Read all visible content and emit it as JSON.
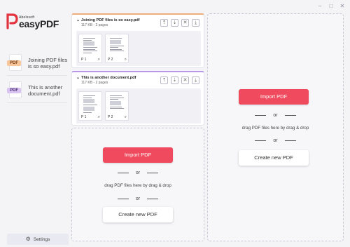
{
  "app": {
    "brand_small": "Abelssoft",
    "brand_name": "easyPDF"
  },
  "window_controls": [
    "–",
    "□",
    "✕"
  ],
  "sidebar": {
    "documents": [
      {
        "tag": "PDF",
        "line1": "Joining PDF files",
        "line2": "is so easy.pdf",
        "color": "#f7c79b"
      },
      {
        "tag": "PDF",
        "line1": "This is another",
        "line2": "document.pdf",
        "color": "#d9c4f1"
      }
    ],
    "settings_label": "Settings"
  },
  "documents": [
    {
      "name": "Joining PDF files is so easy.pdf",
      "meta": "117 KB - 2 pages",
      "accent": "#f1ad79",
      "pages": [
        "P 1",
        "P 2"
      ]
    },
    {
      "name": "This is another document.pdf",
      "meta": "117 KB - 2 pages",
      "accent": "#b897e8",
      "pages": [
        "P 1",
        "P 2"
      ]
    }
  ],
  "drop_zone": {
    "import_label": "Import PDF",
    "or_label": "or",
    "drag_hint": "drag PDF files here by drag & drop",
    "create_label": "Create new PDF"
  },
  "colors": {
    "accent_red": "#ef4a5d"
  }
}
